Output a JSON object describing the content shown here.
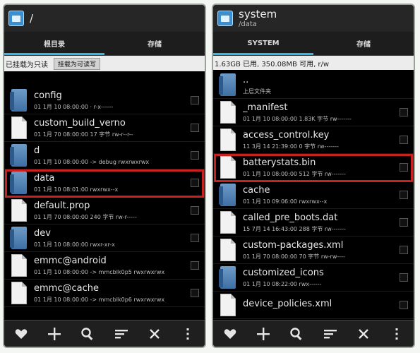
{
  "left_panel": {
    "title": "/",
    "tabs": [
      "根目录",
      "存储"
    ],
    "mount_status": "已挂载为只读",
    "mount_button": "挂载为可读写",
    "items": [
      {
        "name": "config",
        "meta": "01 1月 10 08:00:00 · r-x------",
        "icon": "folder-icon"
      },
      {
        "name": "custom_build_verno",
        "meta": "01 1月 70 08:00:00  17 字节  rw-r--r--",
        "icon": "file-icon"
      },
      {
        "name": "d",
        "meta": "01 1月 10 08:00:00 -> debug  rwxrwxrwx",
        "icon": "folder-icon"
      },
      {
        "name": "data",
        "meta": "01 1月 10 08:01:00    rwxrwx--x",
        "icon": "folder-icon"
      },
      {
        "name": "default.prop",
        "meta": "01 1月 70 08:00:00  240 字节  rw-r-----",
        "icon": "file-icon"
      },
      {
        "name": "dev",
        "meta": "01 1月 10 08:00:00       rwxr-xr-x",
        "icon": "folder-icon"
      },
      {
        "name": "emmc@android",
        "meta": "01 1月 10 08:00:00 -> mmcblk0p5  rwxrwxrwx",
        "icon": "file-icon"
      },
      {
        "name": "emmc@cache",
        "meta": "01 1月 10 08:00:00 -> mmcblk0p6  rwxrwxrwx",
        "icon": "file-icon"
      }
    ]
  },
  "right_panel": {
    "title": "system",
    "subtitle": "/data",
    "tabs": [
      "SYSTEM",
      "存储"
    ],
    "status": "1.63GB 已用, 350.08MB 可用, r/w",
    "items": [
      {
        "name": "..",
        "meta": "上层文件夹",
        "icon": "folder-icon"
      },
      {
        "name": "_manifest",
        "meta": "01 1月 10 08:00:00  1.83K 字节  rw-------",
        "icon": "file-icon"
      },
      {
        "name": "access_control.key",
        "meta": "11 3月 14 21:39:00  0 字节  rw-------",
        "icon": "file-icon"
      },
      {
        "name": "batterystats.bin",
        "meta": "01 1月 10 08:00:00  512 字节  rw-------",
        "icon": "file-icon"
      },
      {
        "name": "cache",
        "meta": "01 1月 10 09:06:00    rwxrwx--x",
        "icon": "folder-icon"
      },
      {
        "name": "called_pre_boots.dat",
        "meta": "15 7月 14 16:43:00  288 字节  rw-------",
        "icon": "file-icon"
      },
      {
        "name": "custom-packages.xml",
        "meta": "01 1月 70 08:00:00  70 字节  rw-rw----",
        "icon": "file-icon"
      },
      {
        "name": "customized_icons",
        "meta": "01 1月 10 08:22:00    rwx------",
        "icon": "folder-icon"
      },
      {
        "name": "device_policies.xml",
        "meta": "",
        "icon": "file-icon"
      }
    ]
  },
  "toolbar_icons": [
    "heart-icon",
    "plus-icon",
    "search-icon",
    "sort-icon",
    "close-icon",
    "more-icon"
  ],
  "highlight_color": "#c8211f"
}
